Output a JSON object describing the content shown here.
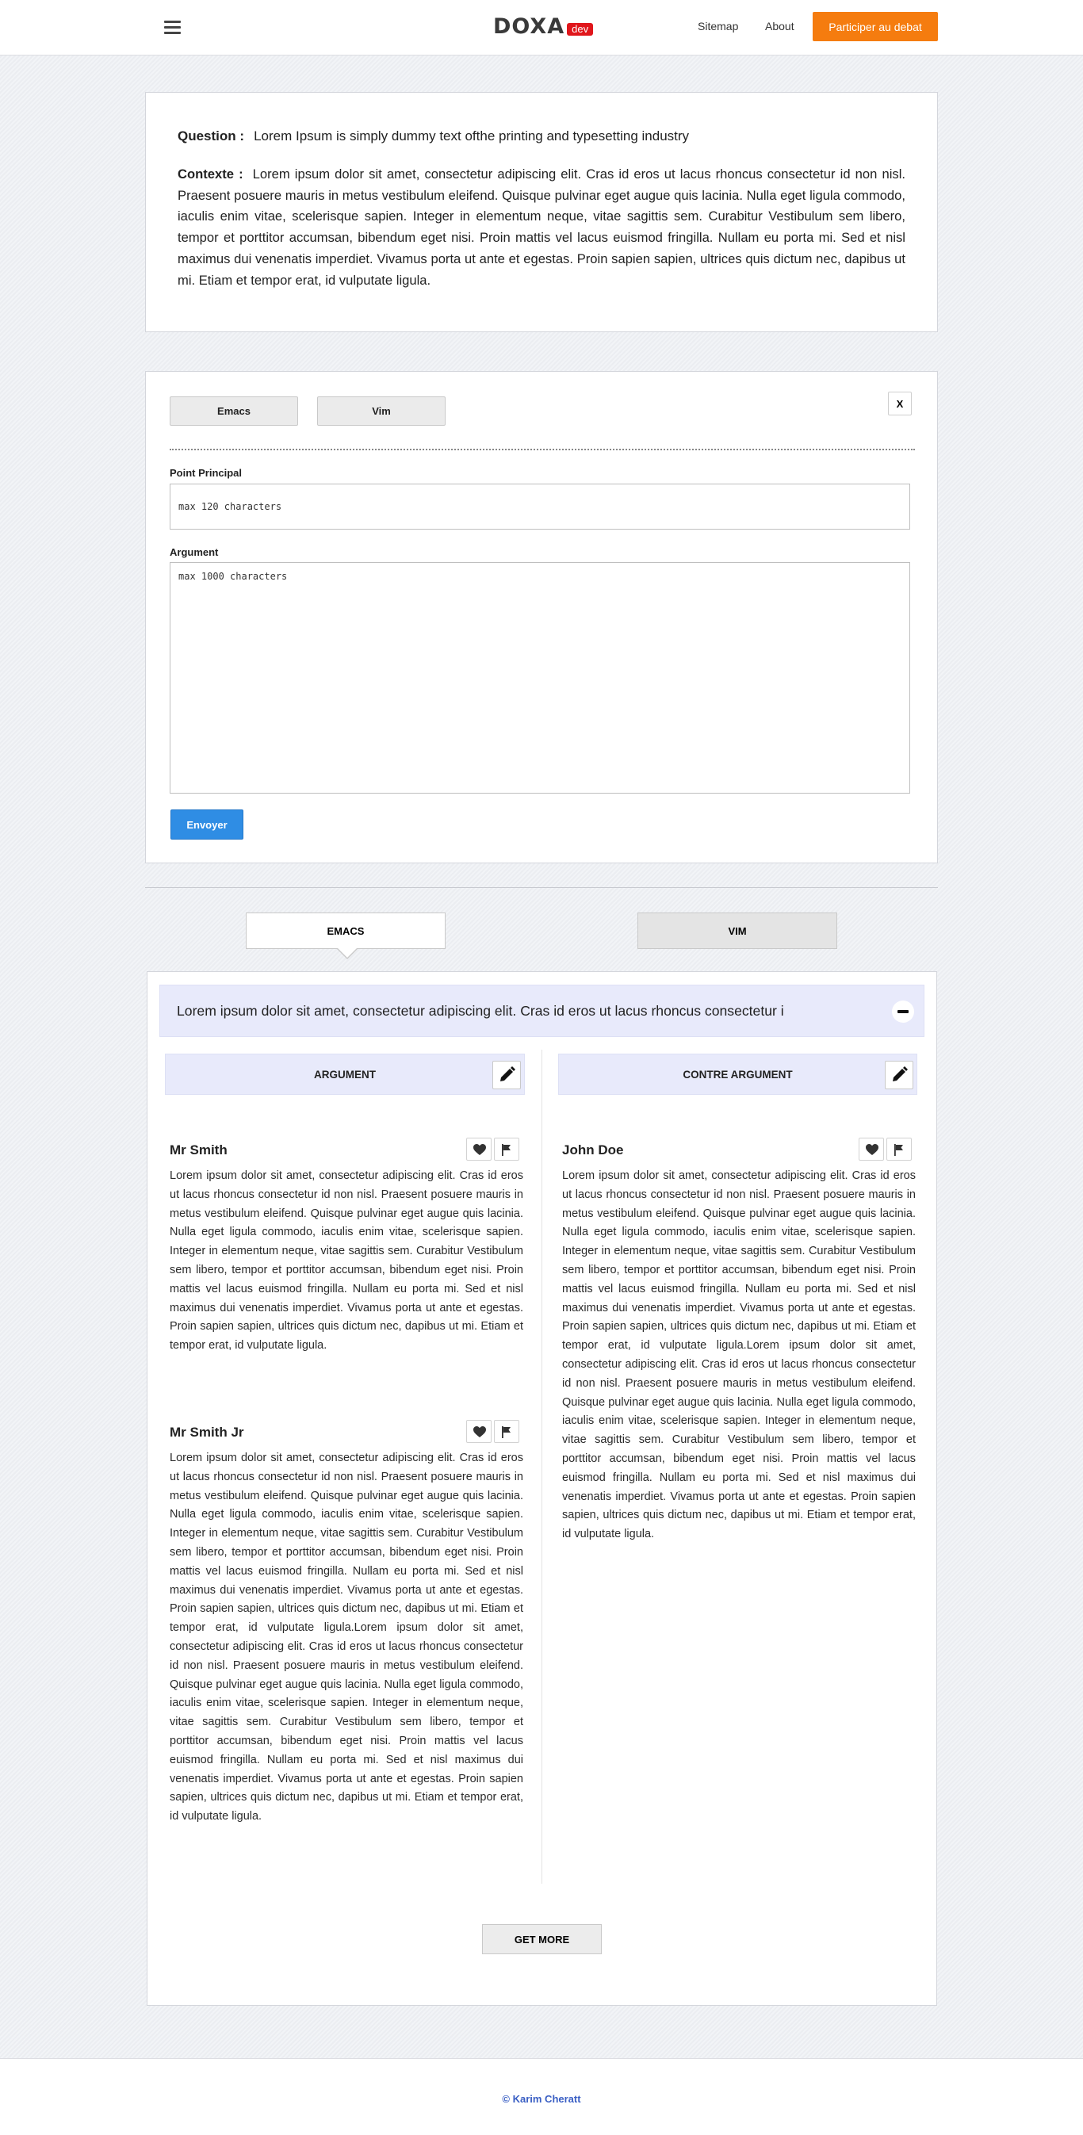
{
  "header": {
    "logo": "DOXA",
    "badge": "dev",
    "nav": {
      "sitemap": "Sitemap",
      "about": "About"
    },
    "cta": "Participer au debat"
  },
  "question_card": {
    "question_label": "Question :",
    "question_text": "Lorem Ipsum is simply dummy text ofthe printing and typesetting industry",
    "context_label": "Contexte :",
    "context_text": "Lorem ipsum dolor sit amet, consectetur adipiscing elit. Cras id eros ut lacus rhoncus consectetur id non nisl. Praesent posuere mauris in metus vestibulum eleifend. Quisque pulvinar eget augue quis lacinia. Nulla eget ligula commodo, iaculis enim vitae, scelerisque sapien. Integer in elementum neque, vitae sagittis sem. Curabitur Vestibulum sem libero, tempor et porttitor accumsan, bibendum eget nisi. Proin mattis vel lacus euismod fringilla. Nullam eu porta mi. Sed et nisl maximus dui venenatis imperdiet. Vivamus porta ut ante et egestas. Proin sapien sapien, ultrices quis dictum nec, dapibus ut mi. Etiam et tempor erat, id vulputate ligula."
  },
  "form": {
    "side_emacs": "Emacs",
    "side_vim": "Vim",
    "close": "X",
    "point_label": "Point Principal",
    "point_placeholder": "max 120 characters",
    "argument_label": "Argument",
    "argument_placeholder": "max 1000 characters",
    "submit": "Envoyer"
  },
  "tabs": {
    "emacs": "EMACS",
    "vim": "VIM"
  },
  "debate": {
    "point": "Lorem ipsum dolor sit amet, consectetur adipiscing elit. Cras id eros ut lacus rhoncus consectetur i",
    "argument_header": "ARGUMENT",
    "counter_header": "CONTRE ARGUMENT",
    "arguments": [
      {
        "author": "Mr Smith",
        "text": "Lorem ipsum dolor sit amet, consectetur adipiscing elit. Cras id eros ut lacus rhoncus consectetur id non nisl. Praesent posuere mauris in metus vestibulum eleifend. Quisque pulvinar eget augue quis lacinia. Nulla eget ligula commodo, iaculis enim vitae, scelerisque sapien. Integer in elementum neque, vitae sagittis sem. Curabitur Vestibulum sem libero, tempor et porttitor accumsan, bibendum eget nisi. Proin mattis vel lacus euismod fringilla. Nullam eu porta mi. Sed et nisl maximus dui venenatis imperdiet. Vivamus porta ut ante et egestas. Proin sapien sapien, ultrices quis dictum nec, dapibus ut mi. Etiam et tempor erat, id vulputate ligula."
      },
      {
        "author": "Mr Smith Jr",
        "text": "Lorem ipsum dolor sit amet, consectetur adipiscing elit. Cras id eros ut lacus rhoncus consectetur id non nisl. Praesent posuere mauris in metus vestibulum eleifend. Quisque pulvinar eget augue quis lacinia. Nulla eget ligula commodo, iaculis enim vitae, scelerisque sapien. Integer in elementum neque, vitae sagittis sem. Curabitur Vestibulum sem libero, tempor et porttitor accumsan, bibendum eget nisi. Proin mattis vel lacus euismod fringilla. Nullam eu porta mi. Sed et nisl maximus dui venenatis imperdiet. Vivamus porta ut ante et egestas. Proin sapien sapien, ultrices quis dictum nec, dapibus ut mi. Etiam et tempor erat, id vulputate ligula.Lorem ipsum dolor sit amet, consectetur adipiscing elit. Cras id eros ut lacus rhoncus consectetur id non nisl. Praesent posuere mauris in metus vestibulum eleifend. Quisque pulvinar eget augue quis lacinia. Nulla eget ligula commodo, iaculis enim vitae, scelerisque sapien. Integer in elementum neque, vitae sagittis sem. Curabitur Vestibulum sem libero, tempor et porttitor accumsan, bibendum eget nisi. Proin mattis vel lacus euismod fringilla. Nullam eu porta mi. Sed et nisl maximus dui venenatis imperdiet. Vivamus porta ut ante et egestas. Proin sapien sapien, ultrices quis dictum nec, dapibus ut mi. Etiam et tempor erat, id vulputate ligula."
      }
    ],
    "counter_arguments": [
      {
        "author": "John Doe",
        "text": "Lorem ipsum dolor sit amet, consectetur adipiscing elit. Cras id eros ut lacus rhoncus consectetur id non nisl. Praesent posuere mauris in metus vestibulum eleifend. Quisque pulvinar eget augue quis lacinia. Nulla eget ligula commodo, iaculis enim vitae, scelerisque sapien. Integer in elementum neque, vitae sagittis sem. Curabitur Vestibulum sem libero, tempor et porttitor accumsan, bibendum eget nisi. Proin mattis vel lacus euismod fringilla. Nullam eu porta mi. Sed et nisl maximus dui venenatis imperdiet. Vivamus porta ut ante et egestas. Proin sapien sapien, ultrices quis dictum nec, dapibus ut mi. Etiam et tempor erat, id vulputate ligula.Lorem ipsum dolor sit amet, consectetur adipiscing elit. Cras id eros ut lacus rhoncus consectetur id non nisl. Praesent posuere mauris in metus vestibulum eleifend. Quisque pulvinar eget augue quis lacinia. Nulla eget ligula commodo, iaculis enim vitae, scelerisque sapien. Integer in elementum neque, vitae sagittis sem. Curabitur Vestibulum sem libero, tempor et porttitor accumsan, bibendum eget nisi. Proin mattis vel lacus euismod fringilla. Nullam eu porta mi. Sed et nisl maximus dui venenatis imperdiet. Vivamus porta ut ante et egestas. Proin sapien sapien, ultrices quis dictum nec, dapibus ut mi. Etiam et tempor erat, id vulputate ligula."
      }
    ],
    "get_more": "GET MORE"
  },
  "footer": {
    "credit": "© Karim Cheratt"
  },
  "colors": {
    "accent": "#f57c0f",
    "primary": "#2f8de4",
    "badge": "#e0161b",
    "highlight": "#e8eafb",
    "footer_link": "#3a5fc4"
  },
  "icons": [
    "menu-icon",
    "minus-icon",
    "pencil-icon",
    "heart-icon",
    "flag-icon"
  ]
}
